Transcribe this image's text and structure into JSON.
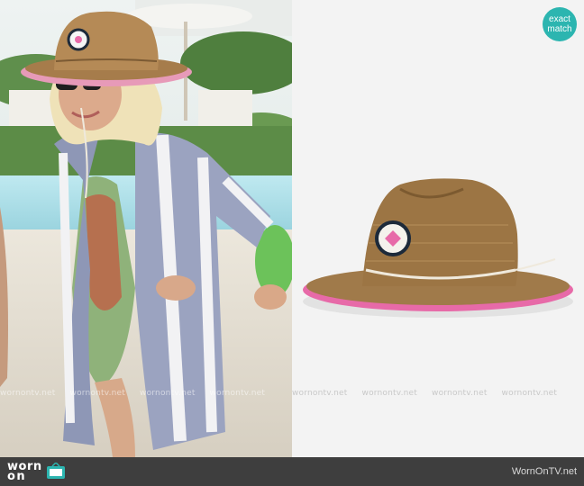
{
  "badge": {
    "line1": "exact",
    "line2": "match"
  },
  "watermark": {
    "text": "wornontv.net"
  },
  "footer": {
    "logo_line1": "worn",
    "logo_line2": "on",
    "site_url": "WornOnTV.net"
  },
  "colors": {
    "badge": "#2cb5b0",
    "footer": "#3e3e3e",
    "hat_straw": "#a07a4a",
    "hat_trim": "#e76aa8"
  },
  "images": [
    {
      "name": "woman-in-straw-hat-by-pool",
      "icon": "photo-icon"
    },
    {
      "name": "straw-lifeguard-hat-product",
      "icon": "photo-icon"
    }
  ]
}
